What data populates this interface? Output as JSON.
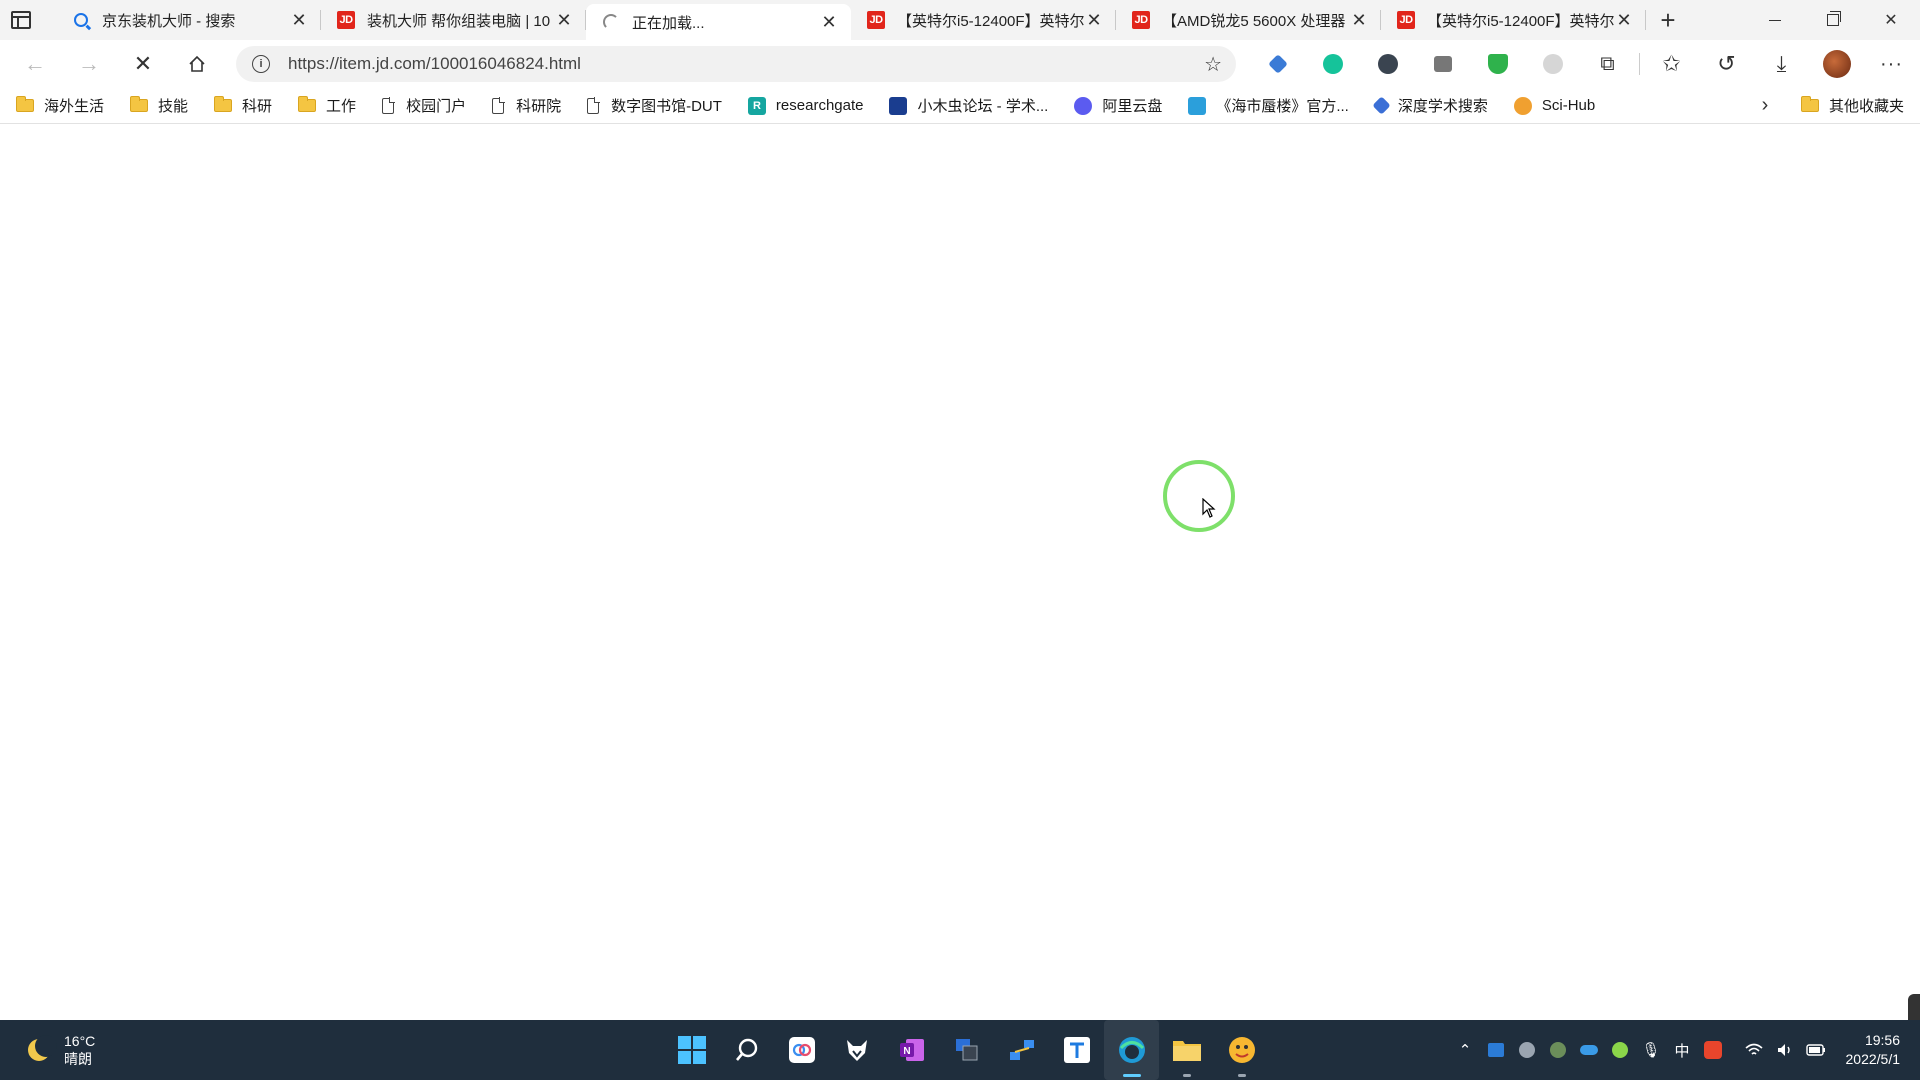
{
  "tabs": [
    {
      "title": "京东装机大师 - 搜索",
      "favicon": "search-favicon",
      "active": false
    },
    {
      "title": "装机大师 帮你组装电脑 | 10",
      "favicon": "jd-favicon",
      "active": false
    },
    {
      "title": "正在加载...",
      "favicon": "loading-favicon",
      "active": true
    },
    {
      "title": "【英特尔i5-12400F】英特尔",
      "favicon": "jd-favicon",
      "active": false
    },
    {
      "title": "【AMD锐龙5 5600X 处理器",
      "favicon": "jd-favicon",
      "active": false
    },
    {
      "title": "【英特尔i5-12400F】英特尔",
      "favicon": "jd-favicon",
      "active": false
    }
  ],
  "jd_favicon_text": "JD",
  "address": {
    "url": "https://item.jd.com/100016046824.html",
    "info_icon": "i"
  },
  "bookmarks": [
    {
      "label": "海外生活",
      "icon": "folder-icon"
    },
    {
      "label": "技能",
      "icon": "folder-icon"
    },
    {
      "label": "科研",
      "icon": "folder-icon"
    },
    {
      "label": "工作",
      "icon": "folder-icon"
    },
    {
      "label": "校园门户",
      "icon": "page-icon"
    },
    {
      "label": "科研院",
      "icon": "page-icon"
    },
    {
      "label": "数字图书馆-DUT",
      "icon": "page-icon"
    },
    {
      "label": "researchgate",
      "icon": "researchgate-icon",
      "badge": "R",
      "color": "#15a6a0"
    },
    {
      "label": "小木虫论坛 - 学术...",
      "icon": "muchong-icon",
      "badge": "",
      "color": "#1a3d8f"
    },
    {
      "label": "阿里云盘",
      "icon": "aliyun-icon",
      "badge": "",
      "color": "#5b5bf0"
    },
    {
      "label": "《海市蜃楼》官方...",
      "icon": "bilibili-icon",
      "badge": "",
      "color": "#2b9fdb"
    },
    {
      "label": "深度学术搜索",
      "icon": "deep-search-icon",
      "badge": "",
      "color": "#3b6fd6"
    },
    {
      "label": "Sci-Hub",
      "icon": "scihub-icon",
      "badge": "",
      "color": "#f0a030"
    }
  ],
  "other_bookmarks": "其他收藏夹",
  "weather": {
    "temp": "16°C",
    "desc": "晴朗"
  },
  "clock": {
    "time": "19:56",
    "date": "2022/5/1"
  },
  "tray_ime": "中",
  "colors": {
    "taskbar": "#1f2e3d",
    "jd_red": "#e1251b",
    "cursor_ring": "#7ee06a",
    "accent": "#60cdff"
  }
}
